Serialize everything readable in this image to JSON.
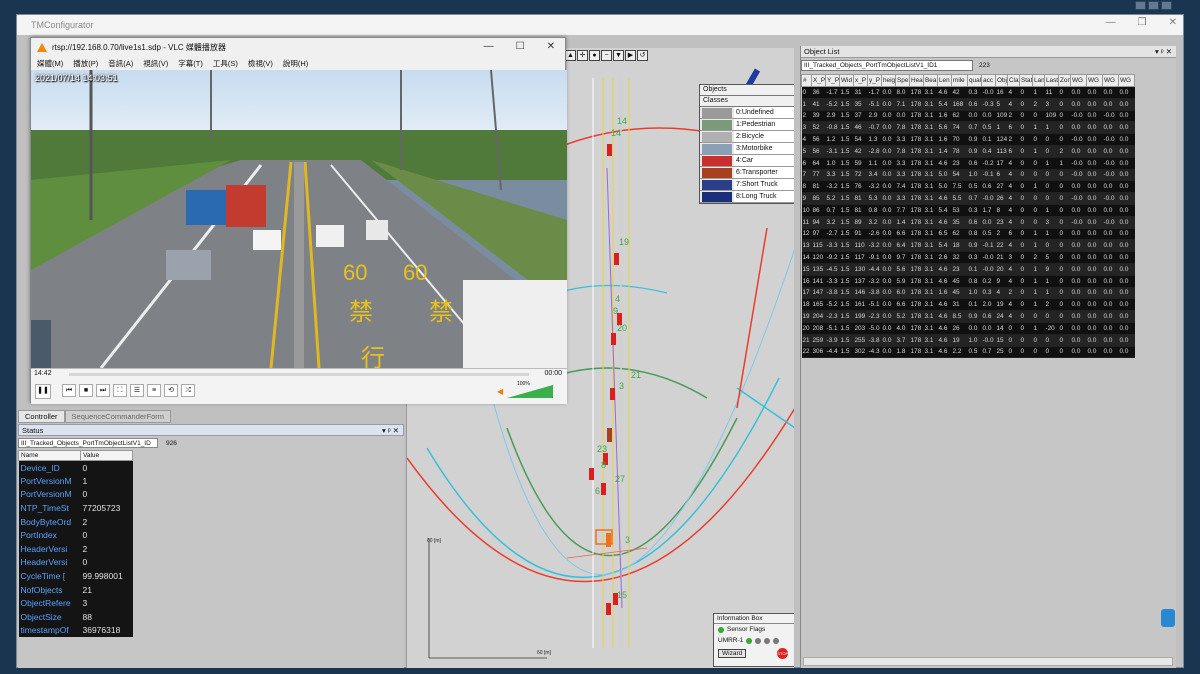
{
  "tm_title": "TMConfigurator",
  "vlc": {
    "title": "rtsp://192.168.0.70/live1s1.sdp - VLC 媒體播放器",
    "menu": [
      "媒體(M)",
      "播放(P)",
      "音訊(A)",
      "視訊(V)",
      "字幕(T)",
      "工具(S)",
      "檢視(V)",
      "說明(H)"
    ],
    "osd_time": "2021/07/14 14:03:51",
    "elapsed": "14:42",
    "remaining": "00:00",
    "volume": "100%",
    "road_marking": "60",
    "road_marking_2": "禁",
    "road_marking_3": "行"
  },
  "controller_tab": "Controller",
  "sequence_tab": "SequenceCommanderForm",
  "status": {
    "title": "Status",
    "selector": "III_Tracked_Objects_PortTmObjectListV1_ID",
    "count": "926",
    "col_name": "Name",
    "col_value": "Value",
    "rows": [
      {
        "k": "Device_ID",
        "v": "0"
      },
      {
        "k": "PortVersionM",
        "v": "1"
      },
      {
        "k": "PortVersionM",
        "v": "0"
      },
      {
        "k": "NTP_TimeSt",
        "v": "77205723"
      },
      {
        "k": "BodyByteOrd",
        "v": "2"
      },
      {
        "k": "PortIndex",
        "v": "0"
      },
      {
        "k": "HeaderVersi",
        "v": "2"
      },
      {
        "k": "HeaderVersi",
        "v": "0"
      },
      {
        "k": "CycleTime [",
        "v": "99.998001"
      },
      {
        "k": "NofObjects",
        "v": "21"
      },
      {
        "k": "ObjectRefere",
        "v": "3"
      },
      {
        "k": "ObjectSize",
        "v": "88"
      },
      {
        "k": "timestampOf",
        "v": "36976318"
      }
    ]
  },
  "legend": {
    "objects": "Objects",
    "classes": "Classes",
    "items": [
      {
        "label": "0:Undefined",
        "color": "#9a9a9a"
      },
      {
        "label": "1:Pedestrian",
        "color": "#7a9a7a"
      },
      {
        "label": "2:Bicycle",
        "color": "#b0b0b0"
      },
      {
        "label": "3:Motorbike",
        "color": "#8aa0b4"
      },
      {
        "label": "4:Car",
        "color": "#c83030"
      },
      {
        "label": "6:Transporter",
        "color": "#a84020"
      },
      {
        "label": "7:Short Truck",
        "color": "#2a3e8a"
      },
      {
        "label": "8:Long Truck",
        "color": "#1a2e7a"
      }
    ]
  },
  "radar": {
    "labels": [
      "14",
      "14",
      "19",
      "4",
      "9",
      "20",
      "21",
      "3",
      "23",
      "8",
      "27",
      "6",
      "3",
      "15"
    ],
    "axis_y": "60 [m]",
    "axis_x": "60 [m]"
  },
  "infobox": {
    "title": "Information Box",
    "sensor_flags": "Sensor Flags",
    "umrr": "UMRR-1",
    "wizard": "Wizard",
    "stop": "STOP"
  },
  "objlist": {
    "title": "Object List",
    "selector": "III_Tracked_Objects_PortTmObjectListV1_ID1",
    "count": "223",
    "columns": [
      "#",
      "X_P",
      "Y_P",
      "Wid",
      "x_P",
      "y_P",
      "heig",
      "Spe",
      "Hea",
      "Bea",
      "Len",
      "mile",
      "qual",
      "acc",
      "Obj",
      "Cla",
      "Stat",
      "Lan",
      "Last",
      "Zon",
      "WG",
      "WG",
      "WG",
      "WG"
    ],
    "rows": [
      [
        "0",
        "36",
        "-1.7",
        "1.5",
        "31",
        "-1.7",
        "0.0",
        "8.0",
        "178",
        "3.1",
        "4.6",
        "42",
        "0.3",
        "-0.0",
        "16",
        "4",
        "0",
        "1",
        "11",
        "0",
        "0.0",
        "0.0",
        "0.0",
        "0.0"
      ],
      [
        "1",
        "41",
        "-5.2",
        "1.5",
        "35",
        "-5.1",
        "0.0",
        "7.1",
        "178",
        "3.1",
        "5.4",
        "168",
        "0.6",
        "-0.3",
        "5",
        "4",
        "0",
        "2",
        "3",
        "0",
        "0.0",
        "0.0",
        "0.0",
        "0.0"
      ],
      [
        "2",
        "39",
        "2.9",
        "1.5",
        "37",
        "2.9",
        "0.0",
        "0.0",
        "178",
        "3.1",
        "1.6",
        "62",
        "0.0",
        "0.0",
        "109",
        "2",
        "0",
        "0",
        "109",
        "0",
        "-0.0",
        "0.0",
        "-0.0",
        "0.0"
      ],
      [
        "3",
        "52",
        "-0.8",
        "1.5",
        "46",
        "-0.7",
        "0.0",
        "7.8",
        "178",
        "3.1",
        "5.6",
        "74",
        "0.7",
        "0.5",
        "1",
        "6",
        "0",
        "1",
        "1",
        "0",
        "0.0",
        "0.0",
        "0.0",
        "0.0"
      ],
      [
        "4",
        "56",
        "1.2",
        "1.5",
        "54",
        "1.3",
        "0.0",
        "3.3",
        "178",
        "3.1",
        "1.6",
        "70",
        "0.9",
        "0.1",
        "124",
        "2",
        "0",
        "0",
        "0",
        "0",
        "-0.0",
        "0.0",
        "-0.0",
        "0.0"
      ],
      [
        "5",
        "56",
        "-3.1",
        "1.5",
        "42",
        "-2.8",
        "0.0",
        "7.8",
        "178",
        "3.1",
        "1.4",
        "78",
        "0.9",
        "0.4",
        "113",
        "6",
        "0",
        "1",
        "0",
        "2",
        "0.0",
        "0.0",
        "0.0",
        "0.0"
      ],
      [
        "6",
        "64",
        "1.0",
        "1.5",
        "59",
        "1.1",
        "0.0",
        "3.3",
        "178",
        "3.1",
        "4.6",
        "23",
        "0.6",
        "-0.2",
        "17",
        "4",
        "0",
        "0",
        "1",
        "1",
        "-0.0",
        "0.0",
        "-0.0",
        "0.0"
      ],
      [
        "7",
        "77",
        "3.3",
        "1.5",
        "72",
        "3.4",
        "0.0",
        "3.3",
        "178",
        "3.1",
        "5.0",
        "54",
        "1.0",
        "-0.1",
        "6",
        "4",
        "0",
        "0",
        "0",
        "0",
        "-0.0",
        "0.0",
        "-0.0",
        "0.0"
      ],
      [
        "8",
        "81",
        "-3.2",
        "1.5",
        "76",
        "-3.2",
        "0.0",
        "7.4",
        "178",
        "3.1",
        "5.0",
        "7.5",
        "0.5",
        "0.6",
        "27",
        "4",
        "0",
        "1",
        "0",
        "0",
        "0.0",
        "0.0",
        "0.0",
        "0.0"
      ],
      [
        "9",
        "85",
        "5.2",
        "1.5",
        "81",
        "5.3",
        "0.0",
        "3.3",
        "178",
        "3.1",
        "4.6",
        "5.5",
        "0.7",
        "-0.0",
        "26",
        "4",
        "0",
        "0",
        "0",
        "0",
        "-0.0",
        "0.0",
        "-0.0",
        "0.0"
      ],
      [
        "10",
        "86",
        "0.7",
        "1.5",
        "81",
        "0.8",
        "0.0",
        "7.7",
        "178",
        "3.1",
        "5.4",
        "53",
        "0.3",
        "1.7",
        "8",
        "4",
        "0",
        "0",
        "1",
        "0",
        "0.0",
        "0.0",
        "0.0",
        "0.0"
      ],
      [
        "11",
        "94",
        "3.2",
        "1.5",
        "89",
        "3.2",
        "0.0",
        "1.4",
        "178",
        "3.1",
        "4.6",
        "35",
        "0.6",
        "0.0",
        "23",
        "4",
        "0",
        "0",
        "3",
        "0",
        "-0.0",
        "0.0",
        "-0.0",
        "0.0"
      ],
      [
        "12",
        "97",
        "-2.7",
        "1.5",
        "91",
        "-2.6",
        "0.0",
        "6.6",
        "178",
        "3.1",
        "6.5",
        "62",
        "0.8",
        "0.5",
        "2",
        "6",
        "0",
        "1",
        "1",
        "0",
        "0.0",
        "0.0",
        "0.0",
        "0.0"
      ],
      [
        "13",
        "115",
        "-3.3",
        "1.5",
        "110",
        "-3.2",
        "0.0",
        "6.4",
        "178",
        "3.1",
        "5.4",
        "18",
        "0.9",
        "-0.1",
        "22",
        "4",
        "0",
        "1",
        "0",
        "0",
        "0.0",
        "0.0",
        "0.0",
        "0.0"
      ],
      [
        "14",
        "120",
        "-9.2",
        "1.5",
        "117",
        "-9.1",
        "0.0",
        "9.7",
        "178",
        "3.1",
        "2.6",
        "32",
        "0.3",
        "-0.0",
        "21",
        "3",
        "0",
        "2",
        "5",
        "0",
        "0.0",
        "0.0",
        "0.0",
        "0.0"
      ],
      [
        "15",
        "135",
        "-4.5",
        "1.5",
        "130",
        "-4.4",
        "0.0",
        "5.6",
        "178",
        "3.1",
        "4.6",
        "23",
        "0.1",
        "-0.0",
        "20",
        "4",
        "0",
        "1",
        "9",
        "0",
        "0.0",
        "0.0",
        "0.0",
        "0.0"
      ],
      [
        "16",
        "141",
        "-3.3",
        "1.5",
        "137",
        "-3.2",
        "0.0",
        "5.9",
        "178",
        "3.1",
        "4.6",
        "45",
        "0.8",
        "0.2",
        "9",
        "4",
        "0",
        "1",
        "1",
        "0",
        "0.0",
        "0.0",
        "0.0",
        "0.0"
      ],
      [
        "17",
        "147",
        "-3.8",
        "1.5",
        "146",
        "-3.8",
        "0.0",
        "6.0",
        "178",
        "3.1",
        "1.6",
        "45",
        "1.0",
        "0.3",
        "4",
        "2",
        "0",
        "1",
        "1",
        "0",
        "0.0",
        "0.0",
        "0.0",
        "0.0"
      ],
      [
        "18",
        "165",
        "-5.2",
        "1.5",
        "161",
        "-5.1",
        "0.0",
        "6.6",
        "178",
        "3.1",
        "4.6",
        "31",
        "0.1",
        "2.0",
        "19",
        "4",
        "0",
        "1",
        "2",
        "0",
        "0.0",
        "0.0",
        "0.0",
        "0.0"
      ],
      [
        "19",
        "204",
        "-2.3",
        "1.5",
        "199",
        "-2.3",
        "0.0",
        "5.2",
        "178",
        "3.1",
        "4.6",
        "8.5",
        "0.9",
        "0.6",
        "24",
        "4",
        "0",
        "0",
        "0",
        "0",
        "0.0",
        "0.0",
        "0.0",
        "0.0"
      ],
      [
        "20",
        "208",
        "-5.1",
        "1.5",
        "203",
        "-5.0",
        "0.0",
        "4.0",
        "178",
        "3.1",
        "4.6",
        "26",
        "0.0",
        "0.0",
        "14",
        "0",
        "0",
        "1",
        "-20",
        "0",
        "0.0",
        "0.0",
        "0.0",
        "0.0"
      ],
      [
        "21",
        "259",
        "-3.9",
        "1.5",
        "255",
        "-3.8",
        "0.0",
        "3.7",
        "178",
        "3.1",
        "4.6",
        "19",
        "1.0",
        "-0.0",
        "15",
        "0",
        "0",
        "0",
        "0",
        "0",
        "0.0",
        "0.0",
        "0.0",
        "0.0"
      ],
      [
        "22",
        "306",
        "-4.4",
        "1.5",
        "302",
        "-4.3",
        "0.0",
        "1.8",
        "178",
        "3.1",
        "4.6",
        "2.2",
        "0.5",
        "0.7",
        "25",
        "0",
        "0",
        "0",
        "0",
        "0",
        "0.0",
        "0.0",
        "0.0",
        "0.0"
      ]
    ]
  }
}
